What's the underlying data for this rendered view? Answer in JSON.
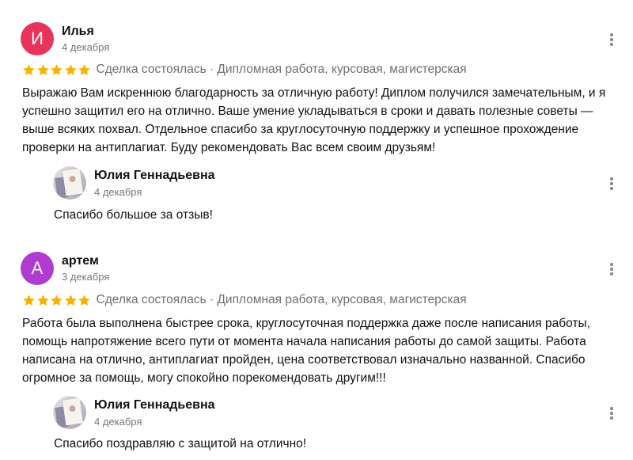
{
  "colors": {
    "star": "#F5B301",
    "avatar_1": "#E8345B",
    "avatar_2": "#B03BD0"
  },
  "reviews": [
    {
      "avatar_letter": "И",
      "author": "Илья",
      "date": "4 декабря",
      "rating": 5,
      "meta": "Сделка состоялась · Дипломная работа, курсовая, магистерская",
      "text": "Выражаю Вам искреннюю благодарность за отличную работу! Диплом получился замечательным, и я успешно защитил его на отлично. Ваше умение укладываться в сроки и давать полезные советы — выше всяких похвал. Отдельное спасибо за круглосуточную поддержку и успешное прохождение проверки на антиплагиат. Буду рекомендовать Вас всем своим друзьям!",
      "reply": {
        "author": "Юлия Геннадьевна",
        "date": "4 декабря",
        "text": "Спасибо большое за отзыв!"
      }
    },
    {
      "avatar_letter": "А",
      "author": "артем",
      "date": "3 декабря",
      "rating": 5,
      "meta": "Сделка состоялась · Дипломная работа, курсовая, магистерская",
      "text": "Работа была выполнена быстрее срока, круглосуточная поддержка даже после написания работы, помощь напротяжение всего пути от момента начала написания работы до самой защиты. Работа написана на отлично, антиплагиат пройден, цена соответствовал изначально названной. Спасибо огромное за помощь, могу спокойно порекомендовать другим!!!",
      "reply": {
        "author": "Юлия Геннадьевна",
        "date": "4 декабря",
        "text": "Спасибо поздравляю с защитой на отлично!"
      }
    }
  ]
}
